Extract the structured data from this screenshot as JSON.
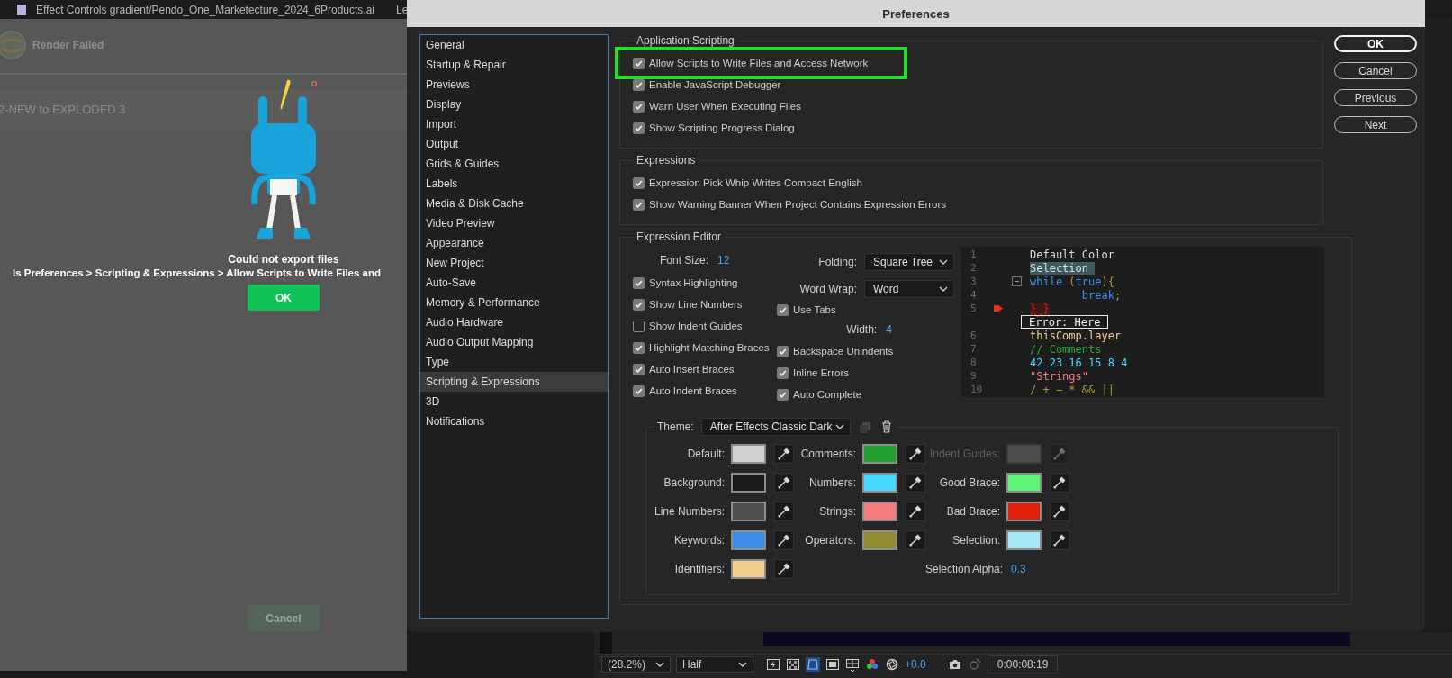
{
  "background_app": {
    "tab_title": "Effect Controls gradient/Pendo_One_Marketecture_2024_6Products.ai",
    "tab_title_2": "Le",
    "dialog": {
      "header": "Render Failed",
      "project": "2-NEW to EXPLODED 3",
      "message_title": "Could not export files",
      "message": "Is Preferences > Scripting & Expressions > Allow Scripts to Write Files and",
      "ok": "OK",
      "cancel": "Cancel"
    },
    "viewer": {
      "zoom": "(28.2%)",
      "resolution": "Half",
      "exposure": "+0.0",
      "timecode": "0:00:08:19"
    }
  },
  "window": {
    "title": "Preferences"
  },
  "sidebar": {
    "items": [
      {
        "label": "General",
        "selected": false
      },
      {
        "label": "Startup & Repair",
        "selected": false
      },
      {
        "label": "Previews",
        "selected": false
      },
      {
        "label": "Display",
        "selected": false
      },
      {
        "label": "Import",
        "selected": false
      },
      {
        "label": "Output",
        "selected": false
      },
      {
        "label": "Grids & Guides",
        "selected": false
      },
      {
        "label": "Labels",
        "selected": false
      },
      {
        "label": "Media & Disk Cache",
        "selected": false
      },
      {
        "label": "Video Preview",
        "selected": false
      },
      {
        "label": "Appearance",
        "selected": false
      },
      {
        "label": "New Project",
        "selected": false
      },
      {
        "label": "Auto-Save",
        "selected": false
      },
      {
        "label": "Memory & Performance",
        "selected": false
      },
      {
        "label": "Audio Hardware",
        "selected": false
      },
      {
        "label": "Audio Output Mapping",
        "selected": false
      },
      {
        "label": "Type",
        "selected": false
      },
      {
        "label": "Scripting & Expressions",
        "selected": true
      },
      {
        "label": "3D",
        "selected": false
      },
      {
        "label": "Notifications",
        "selected": false
      }
    ]
  },
  "buttons": [
    {
      "label": "OK",
      "default": true
    },
    {
      "label": "Cancel",
      "default": false
    },
    {
      "label": "Previous",
      "default": false
    },
    {
      "label": "Next",
      "default": false
    }
  ],
  "application_scripting": {
    "title": "Application Scripting",
    "options": [
      {
        "label": "Allow Scripts to Write Files and Access Network",
        "checked": true,
        "highlighted": true
      },
      {
        "label": "Enable JavaScript Debugger",
        "checked": true,
        "highlighted": false
      },
      {
        "label": "Warn User When Executing Files",
        "checked": true,
        "highlighted": false
      },
      {
        "label": "Show Scripting Progress Dialog",
        "checked": true,
        "highlighted": false
      }
    ]
  },
  "expressions": {
    "title": "Expressions",
    "options": [
      {
        "label": "Expression Pick Whip Writes Compact English",
        "checked": true
      },
      {
        "label": "Show Warning Banner When Project Contains Expression Errors",
        "checked": true
      }
    ]
  },
  "expression_editor": {
    "title": "Expression Editor",
    "font_size": {
      "label": "Font Size:",
      "value": "12"
    },
    "folding": {
      "label": "Folding:",
      "value": "Square Tree"
    },
    "word_wrap": {
      "label": "Word Wrap:",
      "value": "Word"
    },
    "left_options": [
      {
        "label": "Syntax Highlighting",
        "checked": true
      },
      {
        "label": "Show Line Numbers",
        "checked": true
      },
      {
        "label": "Show Indent Guides",
        "checked": false
      },
      {
        "label": "Highlight Matching Braces",
        "checked": true
      },
      {
        "label": "Auto Insert Braces",
        "checked": true
      },
      {
        "label": "Auto Indent Braces",
        "checked": true
      }
    ],
    "use_tabs": {
      "label": "Use Tabs",
      "checked": true
    },
    "width": {
      "label": "Width:",
      "value": "4"
    },
    "right_options": [
      {
        "label": "Backspace Unindents",
        "checked": true
      },
      {
        "label": "Inline Errors",
        "checked": true
      },
      {
        "label": "Auto Complete",
        "checked": true
      }
    ],
    "preview": {
      "lines": [
        {
          "number": "1",
          "tokens": [
            {
              "text": "Default Color",
              "kind": "default"
            }
          ]
        },
        {
          "number": "2",
          "tokens": [
            {
              "text": "Selection ",
              "kind": "selection"
            }
          ]
        },
        {
          "number": "3",
          "fold": true,
          "tokens": [
            {
              "text": "while",
              "kind": "keyword"
            },
            {
              "text": " (",
              "kind": "operator"
            },
            {
              "text": "true",
              "kind": "keyword"
            },
            {
              "text": "){",
              "kind": "operator"
            }
          ]
        },
        {
          "number": "4",
          "tokens": [
            {
              "text": "        break",
              "kind": "keyword"
            },
            {
              "text": ";",
              "kind": "operator"
            }
          ]
        },
        {
          "number": "5",
          "error": true,
          "tokens": [
            {
              "text": "} }",
              "kind": "bad_brace"
            }
          ]
        },
        {
          "kind": "error_message",
          "text": "Error: Here"
        },
        {
          "number": "6",
          "tokens": [
            {
              "text": "thisComp.layer",
              "kind": "identifier"
            }
          ]
        },
        {
          "number": "7",
          "tokens": [
            {
              "text": "// Comments",
              "kind": "comment"
            }
          ]
        },
        {
          "number": "8",
          "tokens": [
            {
              "text": "42 23 16 15 8 4",
              "kind": "number"
            }
          ]
        },
        {
          "number": "9",
          "tokens": [
            {
              "text": "\"Strings\"",
              "kind": "string"
            }
          ]
        },
        {
          "number": "10",
          "tokens": [
            {
              "text": "/ + − * && ||",
              "kind": "operator"
            }
          ]
        }
      ]
    },
    "theme": {
      "label": "Theme:",
      "value": "After Effects Classic Dark",
      "columns": [
        [
          {
            "kind": "swatch",
            "label": "Default:",
            "color": "#d0d0d0",
            "disabled": false
          },
          {
            "kind": "swatch",
            "label": "Background:",
            "color": "#1a1a1a",
            "disabled": false
          },
          {
            "kind": "swatch",
            "label": "Line Numbers:",
            "color": "#505050",
            "disabled": false
          },
          {
            "kind": "swatch",
            "label": "Keywords:",
            "color": "#3b8de8",
            "disabled": false
          },
          {
            "kind": "swatch",
            "label": "Identifiers:",
            "color": "#f0cf8e",
            "disabled": false
          }
        ],
        [
          {
            "kind": "swatch",
            "label": "Comments:",
            "color": "#20a030",
            "disabled": false
          },
          {
            "kind": "swatch",
            "label": "Numbers:",
            "color": "#45d9ff",
            "disabled": false
          },
          {
            "kind": "swatch",
            "label": "Strings:",
            "color": "#f47b7b",
            "disabled": false
          },
          {
            "kind": "swatch",
            "label": "Operators:",
            "color": "#948a30",
            "disabled": false
          }
        ],
        [
          {
            "kind": "swatch",
            "label": "Indent Guides:",
            "color": "#4e4e4e",
            "disabled": true
          },
          {
            "kind": "swatch",
            "label": "Good Brace:",
            "color": "#5ef57a",
            "disabled": false
          },
          {
            "kind": "swatch",
            "label": "Bad Brace:",
            "color": "#e0200c",
            "disabled": false
          },
          {
            "kind": "swatch",
            "label": "Selection:",
            "color": "#a6e6f7",
            "disabled": false
          },
          {
            "kind": "value",
            "label": "Selection Alpha:",
            "value": "0.3"
          }
        ]
      ]
    }
  }
}
